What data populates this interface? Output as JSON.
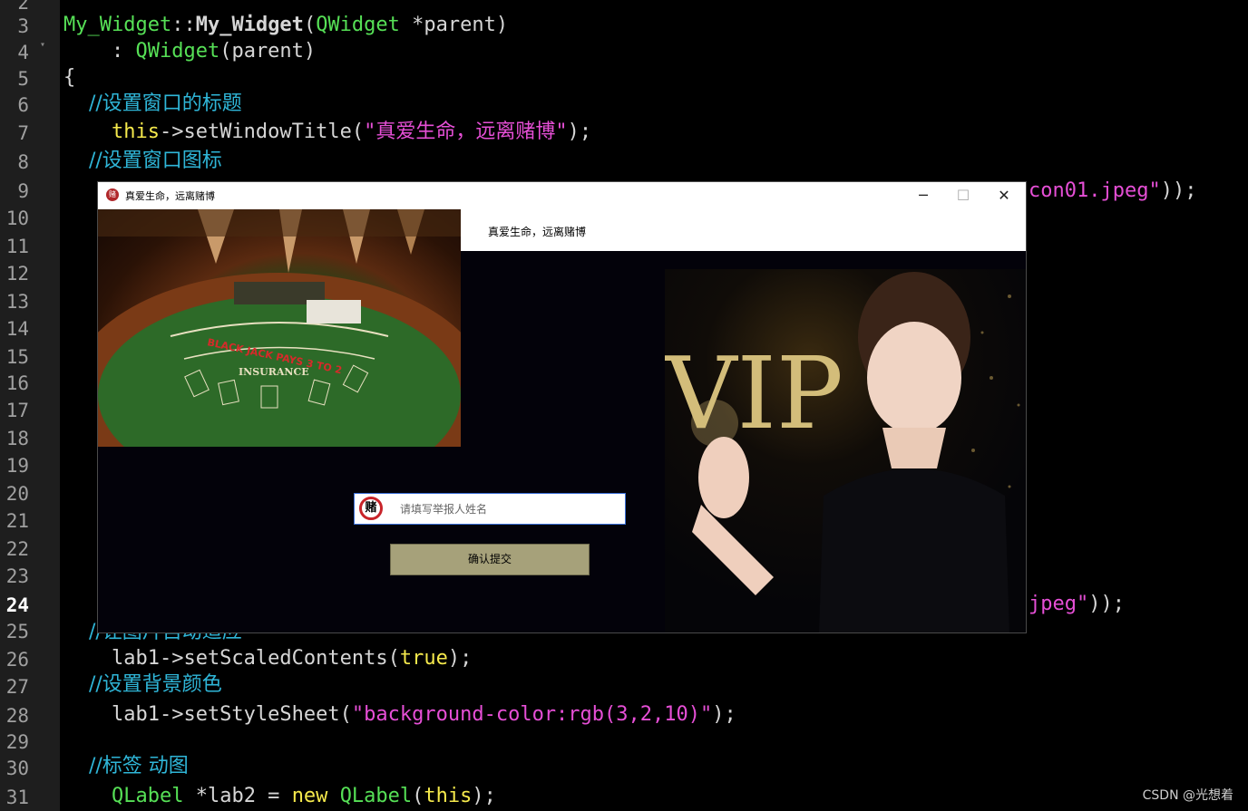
{
  "editor": {
    "line_numbers": [
      "2",
      "3",
      "4",
      "5",
      "6",
      "7",
      "8",
      "9",
      "10",
      "11",
      "12",
      "13",
      "14",
      "15",
      "16",
      "17",
      "18",
      "19",
      "20",
      "21",
      "22",
      "23",
      "24",
      "25",
      "26",
      "27",
      "28",
      "29",
      "30",
      "31"
    ],
    "active_line": "24",
    "lines": {
      "l3": {
        "cls1": "My_Widget",
        "sep": "::",
        "ctor": "My_Widget",
        "paren": "(",
        "cls2": "QWidget",
        "rest": " *parent)"
      },
      "l4": {
        "pre": "    : ",
        "cls": "QWidget",
        "rest": "(parent)"
      },
      "l5": {
        "text": "{"
      },
      "l6": {
        "comment": "    //设置窗口的标题"
      },
      "l7": {
        "kw": "    this",
        "call": "->setWindowTitle(",
        "str": "\"真爱生命，远离赌博\"",
        "end": ");"
      },
      "l8": {
        "comment": "    //设置窗口图标"
      },
      "l9": {
        "str": "con01.jpeg\"",
        "end": "));"
      },
      "l24": {
        "str": "jpeg\"",
        "end": "));"
      },
      "l25": {
        "comment": "    //让图片自动适应"
      },
      "l26": {
        "pre": "    lab1->setScaledContents(",
        "kw": "true",
        "end": ");"
      },
      "l27": {
        "comment": "    //设置背景颜色"
      },
      "l28": {
        "pre": "    lab1->setStyleSheet(",
        "str": "\"background-color:rgb(3,2,10)\"",
        "end": ");"
      },
      "l30": {
        "comment": "    //标签 动图"
      },
      "l31": {
        "pre": "    ",
        "cls": "QLabel",
        "mid": " *lab2 = ",
        "kw1": "new",
        "sp": " ",
        "cls2": "QLabel",
        "paren": "(",
        "kw2": "this",
        "end": ");"
      }
    }
  },
  "window": {
    "title": "真爱生命，远离赌博",
    "icon_glyph": "赌",
    "minimize": "─",
    "maximize": "☐",
    "close": "✕",
    "header_label": "真爱生命，远离赌博",
    "input_icon_glyph": "赌",
    "input_placeholder": "请填写举报人姓名",
    "input_value": "",
    "submit_label": "确认提交",
    "casino_image_text": "BLACK JACK PAYS 3 TO 2",
    "casino_insurance_text": "INSURANCE",
    "vip_image_text": "VIP"
  },
  "watermark": "CSDN @光想着"
}
